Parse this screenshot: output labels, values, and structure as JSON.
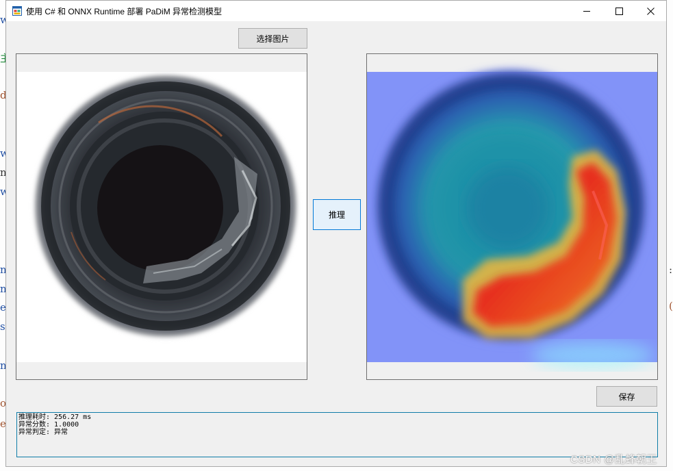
{
  "window": {
    "title": "使用 C# 和 ONNX Runtime 部署 PaDiM 异常检测模型",
    "app_icon": "winforms-app-icon",
    "controls": {
      "minimize_icon": "minimize-icon",
      "maximize_icon": "maximize-icon",
      "close_icon": "close-icon"
    }
  },
  "buttons": {
    "select_image": "选择图片",
    "infer": "推理",
    "save": "保存"
  },
  "images": {
    "input": "bottle-top-view-original",
    "output": "bottle-anomaly-heatmap-overlay"
  },
  "log": {
    "lines": [
      "推理耗时: 256.27 ms",
      "异常分数: 1.0000",
      "异常判定: 异常"
    ]
  },
  "watermark": "CSDN @乱蜂朝王",
  "colors": {
    "accent": "#0078d7",
    "log_border": "#0e7ca7"
  }
}
